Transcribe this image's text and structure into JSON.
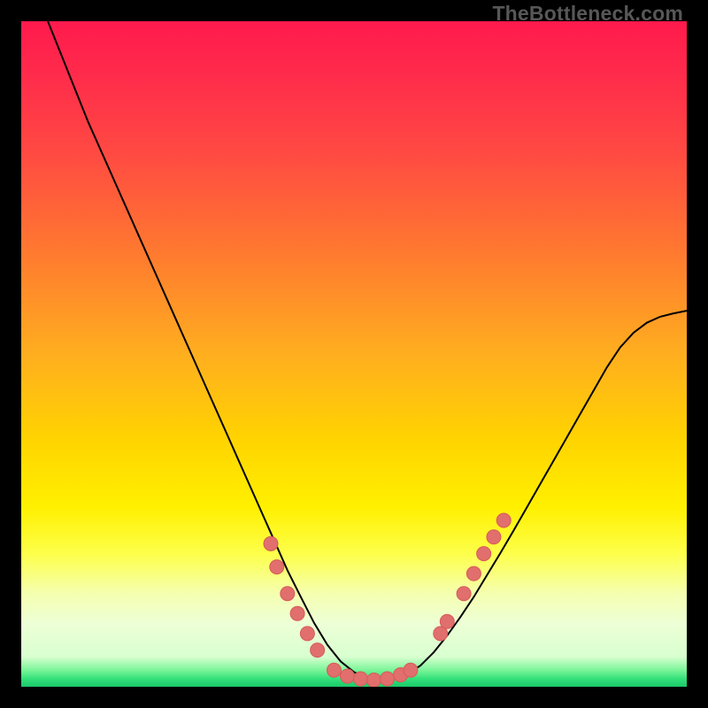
{
  "watermark": "TheBottleneck.com",
  "colors": {
    "frame": "#000000",
    "curve": "#000000",
    "marker_fill": "#e06f6d",
    "marker_stroke": "#d85a58",
    "gradient_stops": [
      {
        "offset": 0.0,
        "color": "#ff1a4d"
      },
      {
        "offset": 0.08,
        "color": "#ff2b4b"
      },
      {
        "offset": 0.2,
        "color": "#ff4a42"
      },
      {
        "offset": 0.35,
        "color": "#ff7a2f"
      },
      {
        "offset": 0.5,
        "color": "#ffae1f"
      },
      {
        "offset": 0.63,
        "color": "#ffd400"
      },
      {
        "offset": 0.73,
        "color": "#fff000"
      },
      {
        "offset": 0.8,
        "color": "#fdff4a"
      },
      {
        "offset": 0.86,
        "color": "#f5ffb0"
      },
      {
        "offset": 0.905,
        "color": "#edffd6"
      },
      {
        "offset": 0.955,
        "color": "#d8ffcf"
      },
      {
        "offset": 0.975,
        "color": "#7af598"
      },
      {
        "offset": 0.988,
        "color": "#33e07a"
      },
      {
        "offset": 1.0,
        "color": "#19c96a"
      }
    ]
  },
  "chart_data": {
    "type": "line",
    "title": "",
    "xlabel": "",
    "ylabel": "",
    "xlim": [
      0,
      100
    ],
    "ylim": [
      0,
      100
    ],
    "grid": false,
    "series": [
      {
        "name": "bottleneck-curve",
        "kind": "line",
        "x": [
          4,
          6,
          8,
          10,
          12,
          14,
          16,
          18,
          20,
          22,
          24,
          26,
          28,
          30,
          32,
          34,
          36,
          38,
          40,
          42,
          44,
          46,
          48,
          50,
          52,
          54,
          56,
          58,
          60,
          62,
          64,
          66,
          68,
          70,
          72,
          74,
          76,
          78,
          80,
          82,
          84,
          86,
          88,
          90,
          92,
          94,
          96,
          98,
          100
        ],
        "y": [
          100,
          95,
          90,
          85,
          80.5,
          76,
          71.5,
          67,
          62.5,
          58,
          53.5,
          49,
          44.5,
          40,
          35.5,
          31,
          26.5,
          22,
          17.5,
          13.5,
          9.6,
          6.3,
          3.8,
          2.2,
          1.3,
          1.0,
          1.2,
          1.9,
          3.2,
          5.2,
          7.7,
          10.5,
          13.5,
          16.8,
          20.1,
          23.5,
          27.0,
          30.5,
          34.0,
          37.5,
          41.0,
          44.5,
          48.0,
          51.0,
          53.2,
          54.7,
          55.6,
          56.1,
          56.5
        ]
      },
      {
        "name": "left-markers",
        "kind": "scatter",
        "x": [
          37.5,
          38.4,
          40.0,
          41.5,
          43.0,
          44.5
        ],
        "y": [
          21.5,
          18.0,
          14.0,
          11.0,
          8.0,
          5.5
        ]
      },
      {
        "name": "bottom-markers",
        "kind": "scatter",
        "x": [
          47.0,
          49.0,
          51.0,
          53.0,
          55.0,
          57.0,
          58.5
        ],
        "y": [
          2.5,
          1.6,
          1.2,
          1.0,
          1.2,
          1.8,
          2.5
        ]
      },
      {
        "name": "right-markers",
        "kind": "scatter",
        "x": [
          63.0,
          64.0,
          66.5,
          68.0,
          69.5,
          71.0,
          72.5
        ],
        "y": [
          8.0,
          9.8,
          14.0,
          17.0,
          20.0,
          22.5,
          25.0
        ]
      }
    ],
    "annotations": [
      {
        "text": "TheBottleneck.com",
        "x": 99,
        "y": 99,
        "anchor": "top-right"
      }
    ]
  }
}
